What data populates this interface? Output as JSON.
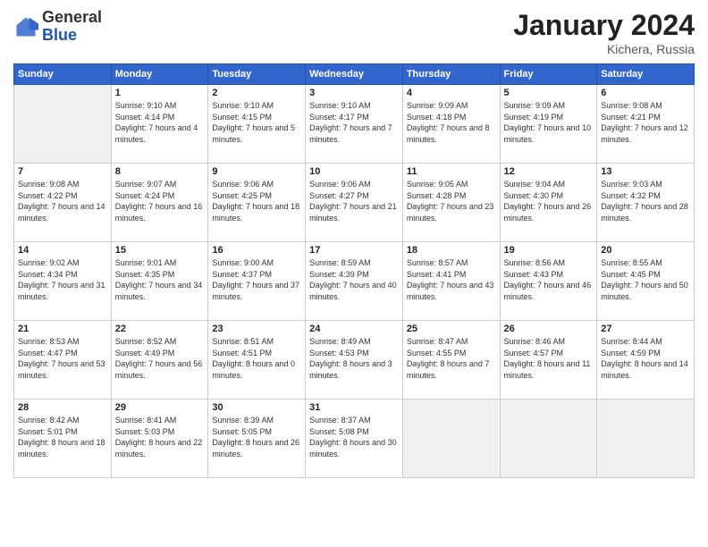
{
  "header": {
    "logo_general": "General",
    "logo_blue": "Blue",
    "title": "January 2024",
    "location": "Kichera, Russia"
  },
  "days_of_week": [
    "Sunday",
    "Monday",
    "Tuesday",
    "Wednesday",
    "Thursday",
    "Friday",
    "Saturday"
  ],
  "weeks": [
    [
      {
        "day": "",
        "sunrise": "",
        "sunset": "",
        "daylight": ""
      },
      {
        "day": "1",
        "sunrise": "Sunrise: 9:10 AM",
        "sunset": "Sunset: 4:14 PM",
        "daylight": "Daylight: 7 hours and 4 minutes."
      },
      {
        "day": "2",
        "sunrise": "Sunrise: 9:10 AM",
        "sunset": "Sunset: 4:15 PM",
        "daylight": "Daylight: 7 hours and 5 minutes."
      },
      {
        "day": "3",
        "sunrise": "Sunrise: 9:10 AM",
        "sunset": "Sunset: 4:17 PM",
        "daylight": "Daylight: 7 hours and 7 minutes."
      },
      {
        "day": "4",
        "sunrise": "Sunrise: 9:09 AM",
        "sunset": "Sunset: 4:18 PM",
        "daylight": "Daylight: 7 hours and 8 minutes."
      },
      {
        "day": "5",
        "sunrise": "Sunrise: 9:09 AM",
        "sunset": "Sunset: 4:19 PM",
        "daylight": "Daylight: 7 hours and 10 minutes."
      },
      {
        "day": "6",
        "sunrise": "Sunrise: 9:08 AM",
        "sunset": "Sunset: 4:21 PM",
        "daylight": "Daylight: 7 hours and 12 minutes."
      }
    ],
    [
      {
        "day": "7",
        "sunrise": "Sunrise: 9:08 AM",
        "sunset": "Sunset: 4:22 PM",
        "daylight": "Daylight: 7 hours and 14 minutes."
      },
      {
        "day": "8",
        "sunrise": "Sunrise: 9:07 AM",
        "sunset": "Sunset: 4:24 PM",
        "daylight": "Daylight: 7 hours and 16 minutes."
      },
      {
        "day": "9",
        "sunrise": "Sunrise: 9:06 AM",
        "sunset": "Sunset: 4:25 PM",
        "daylight": "Daylight: 7 hours and 18 minutes."
      },
      {
        "day": "10",
        "sunrise": "Sunrise: 9:06 AM",
        "sunset": "Sunset: 4:27 PM",
        "daylight": "Daylight: 7 hours and 21 minutes."
      },
      {
        "day": "11",
        "sunrise": "Sunrise: 9:05 AM",
        "sunset": "Sunset: 4:28 PM",
        "daylight": "Daylight: 7 hours and 23 minutes."
      },
      {
        "day": "12",
        "sunrise": "Sunrise: 9:04 AM",
        "sunset": "Sunset: 4:30 PM",
        "daylight": "Daylight: 7 hours and 26 minutes."
      },
      {
        "day": "13",
        "sunrise": "Sunrise: 9:03 AM",
        "sunset": "Sunset: 4:32 PM",
        "daylight": "Daylight: 7 hours and 28 minutes."
      }
    ],
    [
      {
        "day": "14",
        "sunrise": "Sunrise: 9:02 AM",
        "sunset": "Sunset: 4:34 PM",
        "daylight": "Daylight: 7 hours and 31 minutes."
      },
      {
        "day": "15",
        "sunrise": "Sunrise: 9:01 AM",
        "sunset": "Sunset: 4:35 PM",
        "daylight": "Daylight: 7 hours and 34 minutes."
      },
      {
        "day": "16",
        "sunrise": "Sunrise: 9:00 AM",
        "sunset": "Sunset: 4:37 PM",
        "daylight": "Daylight: 7 hours and 37 minutes."
      },
      {
        "day": "17",
        "sunrise": "Sunrise: 8:59 AM",
        "sunset": "Sunset: 4:39 PM",
        "daylight": "Daylight: 7 hours and 40 minutes."
      },
      {
        "day": "18",
        "sunrise": "Sunrise: 8:57 AM",
        "sunset": "Sunset: 4:41 PM",
        "daylight": "Daylight: 7 hours and 43 minutes."
      },
      {
        "day": "19",
        "sunrise": "Sunrise: 8:56 AM",
        "sunset": "Sunset: 4:43 PM",
        "daylight": "Daylight: 7 hours and 46 minutes."
      },
      {
        "day": "20",
        "sunrise": "Sunrise: 8:55 AM",
        "sunset": "Sunset: 4:45 PM",
        "daylight": "Daylight: 7 hours and 50 minutes."
      }
    ],
    [
      {
        "day": "21",
        "sunrise": "Sunrise: 8:53 AM",
        "sunset": "Sunset: 4:47 PM",
        "daylight": "Daylight: 7 hours and 53 minutes."
      },
      {
        "day": "22",
        "sunrise": "Sunrise: 8:52 AM",
        "sunset": "Sunset: 4:49 PM",
        "daylight": "Daylight: 7 hours and 56 minutes."
      },
      {
        "day": "23",
        "sunrise": "Sunrise: 8:51 AM",
        "sunset": "Sunset: 4:51 PM",
        "daylight": "Daylight: 8 hours and 0 minutes."
      },
      {
        "day": "24",
        "sunrise": "Sunrise: 8:49 AM",
        "sunset": "Sunset: 4:53 PM",
        "daylight": "Daylight: 8 hours and 3 minutes."
      },
      {
        "day": "25",
        "sunrise": "Sunrise: 8:47 AM",
        "sunset": "Sunset: 4:55 PM",
        "daylight": "Daylight: 8 hours and 7 minutes."
      },
      {
        "day": "26",
        "sunrise": "Sunrise: 8:46 AM",
        "sunset": "Sunset: 4:57 PM",
        "daylight": "Daylight: 8 hours and 11 minutes."
      },
      {
        "day": "27",
        "sunrise": "Sunrise: 8:44 AM",
        "sunset": "Sunset: 4:59 PM",
        "daylight": "Daylight: 8 hours and 14 minutes."
      }
    ],
    [
      {
        "day": "28",
        "sunrise": "Sunrise: 8:42 AM",
        "sunset": "Sunset: 5:01 PM",
        "daylight": "Daylight: 8 hours and 18 minutes."
      },
      {
        "day": "29",
        "sunrise": "Sunrise: 8:41 AM",
        "sunset": "Sunset: 5:03 PM",
        "daylight": "Daylight: 8 hours and 22 minutes."
      },
      {
        "day": "30",
        "sunrise": "Sunrise: 8:39 AM",
        "sunset": "Sunset: 5:05 PM",
        "daylight": "Daylight: 8 hours and 26 minutes."
      },
      {
        "day": "31",
        "sunrise": "Sunrise: 8:37 AM",
        "sunset": "Sunset: 5:08 PM",
        "daylight": "Daylight: 8 hours and 30 minutes."
      },
      {
        "day": "",
        "sunrise": "",
        "sunset": "",
        "daylight": ""
      },
      {
        "day": "",
        "sunrise": "",
        "sunset": "",
        "daylight": ""
      },
      {
        "day": "",
        "sunrise": "",
        "sunset": "",
        "daylight": ""
      }
    ]
  ]
}
